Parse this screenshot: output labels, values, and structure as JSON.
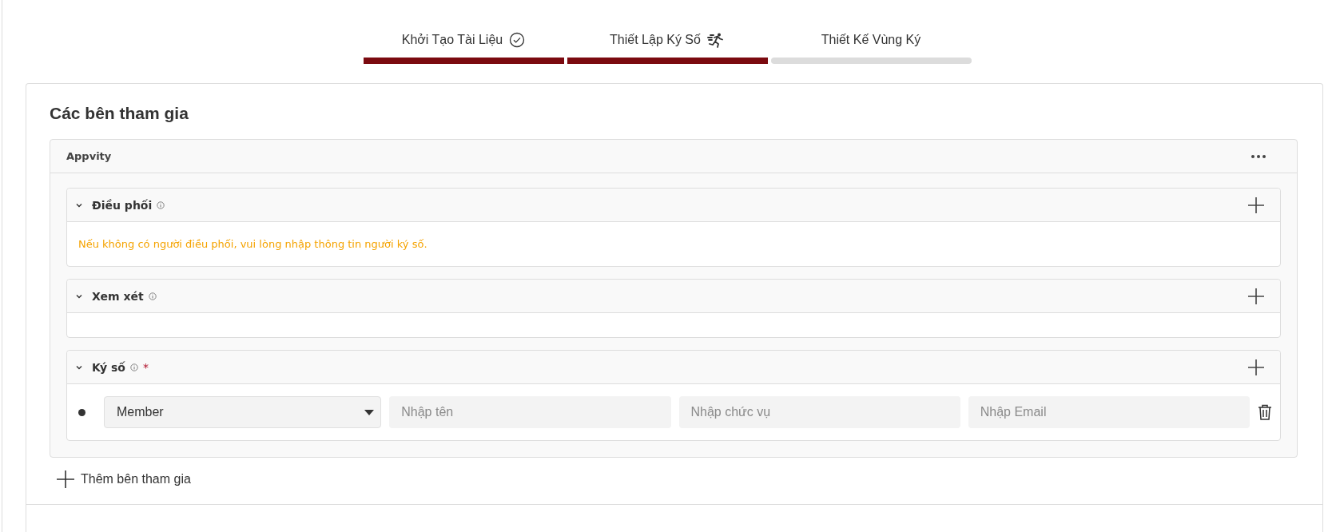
{
  "steps": [
    {
      "label": "Khởi Tạo Tài Liệu",
      "completed": true,
      "active": false
    },
    {
      "label": "Thiết Lập Ký Số",
      "completed": true,
      "active": true
    },
    {
      "label": "Thiết Kế Vùng Ký",
      "completed": false,
      "active": false
    }
  ],
  "participants": {
    "title": "Các bên tham gia",
    "party": {
      "name": "Appvity",
      "sections": [
        {
          "kind": "message",
          "title": "Điều phối",
          "expanded": true,
          "message": "Nếu không có người điều phối, vui lòng nhập thông tin người ký số."
        },
        {
          "kind": "empty",
          "title": "Xem xét",
          "expanded": true
        },
        {
          "kind": "rows",
          "title": "Ký số",
          "required_mark": "*",
          "expanded": true,
          "rows": [
            {
              "role": "Member",
              "name_placeholder": "Nhập tên",
              "position_placeholder": "Nhập chức vụ",
              "email_placeholder": "Nhập Email"
            }
          ]
        }
      ]
    },
    "add_label": "Thêm bên tham gia"
  }
}
